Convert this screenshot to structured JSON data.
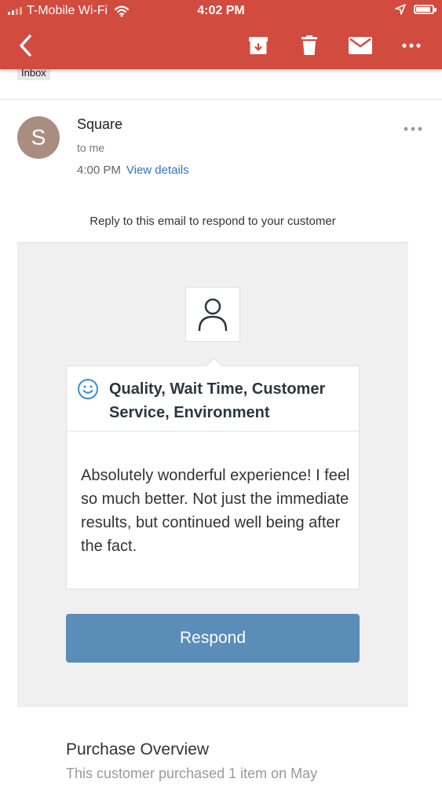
{
  "status_bar": {
    "carrier": "T-Mobile Wi-Fi",
    "time": "4:02 PM",
    "battery_level": 0.9
  },
  "toolbar": {
    "icons": [
      "back-icon",
      "archive-icon",
      "trash-icon",
      "mail-icon",
      "more-icon"
    ]
  },
  "label_chip": "Inbox",
  "email": {
    "avatar_letter": "S",
    "sender": "Square",
    "to": "to me",
    "time": "4:00 PM",
    "view_details": "View details"
  },
  "reply_note": "Reply to this email to respond to your customer",
  "review": {
    "tags": "Quality, Wait Time, Customer Service, Environment",
    "text": "Absolutely wonderful experience! I feel so much better. Not just the immediate results, but continued well being after the fact."
  },
  "respond_label": "Respond",
  "purchase": {
    "title": "Purchase Overview",
    "text": "This customer purchased 1 item on May"
  },
  "colors": {
    "header": "#d24b3f",
    "respond_button": "#5a8db8",
    "link": "#2f74c0",
    "avatar": "#a88d80"
  }
}
